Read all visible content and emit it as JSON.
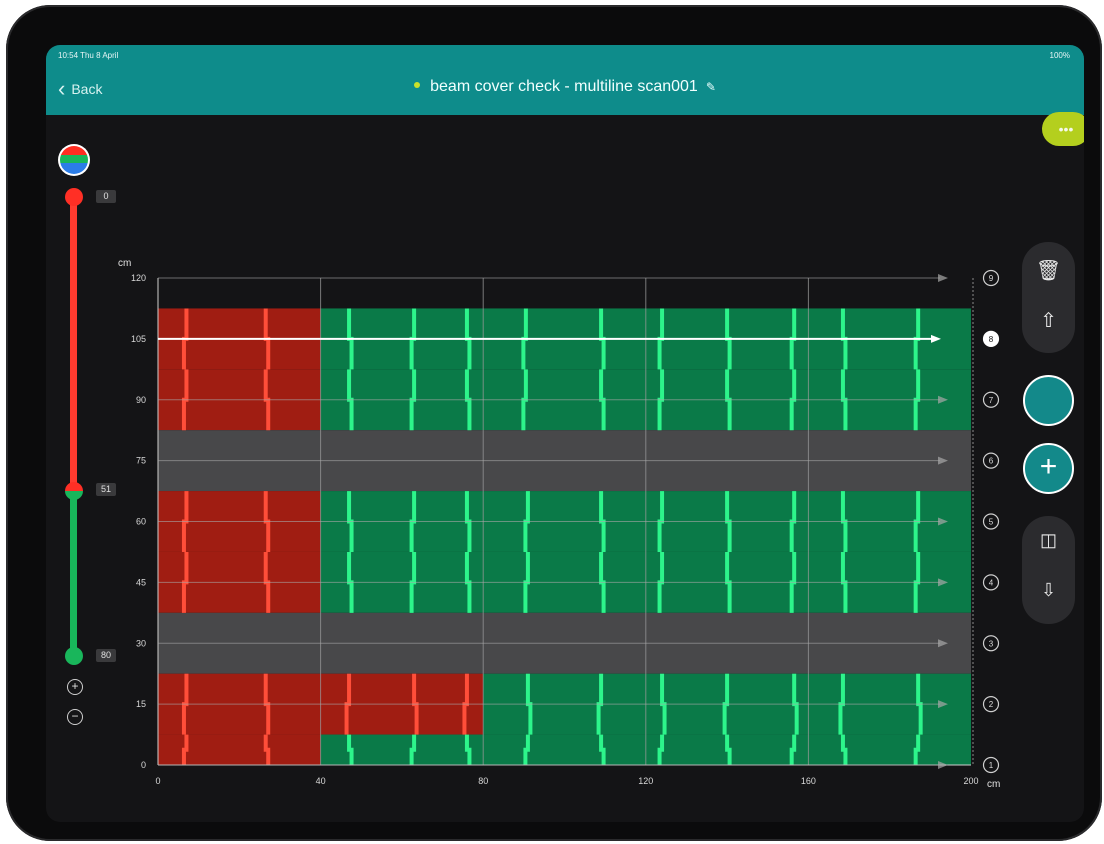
{
  "status": {
    "time": "10:54  Thu 8 April",
    "battery": "100%"
  },
  "nav": {
    "back_label": "Back",
    "title": "beam cover check - multiline scan001"
  },
  "more_label": "•••",
  "slider": {
    "labels": [
      "0",
      "51",
      "80"
    ]
  },
  "icons": {
    "layer": "layer-legend-icon",
    "trash": "trash-icon",
    "share": "share-icon",
    "split": "split-view-icon",
    "probe": "probe-icon",
    "add": "plus-icon",
    "edit": "pencil-icon",
    "zoom_in": "zoom-in-icon",
    "zoom_out": "zoom-out-icon"
  },
  "colors": {
    "teal": "#0e8c8b",
    "lime": "#b4cf1e",
    "red_zone": "#a01d12",
    "green_zone": "#0a7a48",
    "gap": "#48484a",
    "rebar_red": "#ff4e39",
    "rebar_green": "#2df58b"
  },
  "chart_data": {
    "type": "heatmap",
    "xlabel": "cm",
    "ylabel": "cm",
    "xlim": [
      0,
      200
    ],
    "ylim": [
      0,
      120
    ],
    "x_ticks": [
      "0",
      "40",
      "80",
      "120",
      "160",
      "200"
    ],
    "y_ticks": [
      "0",
      "15",
      "30",
      "45",
      "60",
      "75",
      "90",
      "105",
      "120"
    ],
    "x_gridlines": [
      40,
      80,
      120,
      160
    ],
    "scan_lines": [
      {
        "id": "1",
        "y": 0,
        "selected": false
      },
      {
        "id": "2",
        "y": 15,
        "selected": false
      },
      {
        "id": "3",
        "y": 30,
        "selected": false
      },
      {
        "id": "4",
        "y": 45,
        "selected": false
      },
      {
        "id": "5",
        "y": 60,
        "selected": false
      },
      {
        "id": "6",
        "y": 75,
        "selected": false
      },
      {
        "id": "7",
        "y": 90,
        "selected": false
      },
      {
        "id": "8",
        "y": 105,
        "selected": true
      },
      {
        "id": "9",
        "y": 120,
        "selected": false
      }
    ],
    "bands": [
      {
        "y_range": [
          97.5,
          112.5
        ],
        "regions": [
          {
            "x_range": [
              0,
              40
            ],
            "y_range": [
              97.5,
              112.5
            ],
            "zone": "red"
          },
          {
            "x_range": [
              40,
              200
            ],
            "y_range": [
              97.5,
              112.5
            ],
            "zone": "green"
          }
        ],
        "rebars_red": [
          7,
          26.5
        ],
        "rebars_green": [
          47,
          63,
          76,
          90.5,
          109,
          124,
          140,
          156.5,
          168.5,
          187
        ]
      },
      {
        "y_range": [
          82.5,
          97.5
        ],
        "regions": [
          {
            "x_range": [
              0,
              40
            ],
            "y_range": [
              82.5,
              97.5
            ],
            "zone": "red"
          },
          {
            "x_range": [
              40,
              200
            ],
            "y_range": [
              82.5,
              97.5
            ],
            "zone": "green"
          }
        ],
        "rebars_red": [
          7,
          26.5
        ],
        "rebars_green": [
          47,
          63,
          76,
          90.5,
          109,
          124,
          140,
          156.5,
          168.5,
          187
        ]
      },
      {
        "y_range": [
          67.5,
          82.5
        ],
        "regions": [
          {
            "x_range": [
              0,
              200
            ],
            "y_range": [
              67.5,
              82.5
            ],
            "zone": "gap"
          }
        ],
        "rebars_red": [],
        "rebars_green": []
      },
      {
        "y_range": [
          52.5,
          67.5
        ],
        "regions": [
          {
            "x_range": [
              0,
              40
            ],
            "y_range": [
              52.5,
              67.5
            ],
            "zone": "red"
          },
          {
            "x_range": [
              40,
              200
            ],
            "y_range": [
              52.5,
              67.5
            ],
            "zone": "green"
          }
        ],
        "rebars_red": [
          7,
          26.5
        ],
        "rebars_green": [
          47,
          63,
          76,
          91,
          109,
          124,
          140,
          156.5,
          168.5,
          187
        ]
      },
      {
        "y_range": [
          37.5,
          52.5
        ],
        "regions": [
          {
            "x_range": [
              0,
              40
            ],
            "y_range": [
              37.5,
              52.5
            ],
            "zone": "red"
          },
          {
            "x_range": [
              40,
              200
            ],
            "y_range": [
              37.5,
              52.5
            ],
            "zone": "green"
          }
        ],
        "rebars_red": [
          7,
          26.5
        ],
        "rebars_green": [
          47,
          63,
          76,
          91,
          109,
          124,
          140,
          156.5,
          168.5,
          187
        ]
      },
      {
        "y_range": [
          22.5,
          37.5
        ],
        "regions": [
          {
            "x_range": [
              0,
              200
            ],
            "y_range": [
              22.5,
              37.5
            ],
            "zone": "gap"
          }
        ],
        "rebars_red": [],
        "rebars_green": []
      },
      {
        "y_range": [
          7.5,
          22.5
        ],
        "regions": [
          {
            "x_range": [
              0,
              80
            ],
            "y_range": [
              7.5,
              22.5
            ],
            "zone": "red"
          },
          {
            "x_range": [
              80,
              200
            ],
            "y_range": [
              7.5,
              22.5
            ],
            "zone": "green"
          }
        ],
        "rebars_red": [
          7,
          26.5,
          47,
          63,
          76
        ],
        "rebars_green": [
          91,
          109,
          124,
          140,
          156.5,
          168.5,
          187
        ]
      },
      {
        "y_range": [
          0,
          7.5
        ],
        "regions": [
          {
            "x_range": [
              0,
              40
            ],
            "y_range": [
              0,
              7.5
            ],
            "zone": "red"
          },
          {
            "x_range": [
              40,
              200
            ],
            "y_range": [
              0,
              7.5
            ],
            "zone": "green"
          }
        ],
        "rebars_red": [
          7,
          26.5
        ],
        "rebars_green": [
          47,
          63,
          76,
          91,
          109,
          124,
          140,
          156.5,
          168.5,
          187
        ]
      }
    ]
  }
}
